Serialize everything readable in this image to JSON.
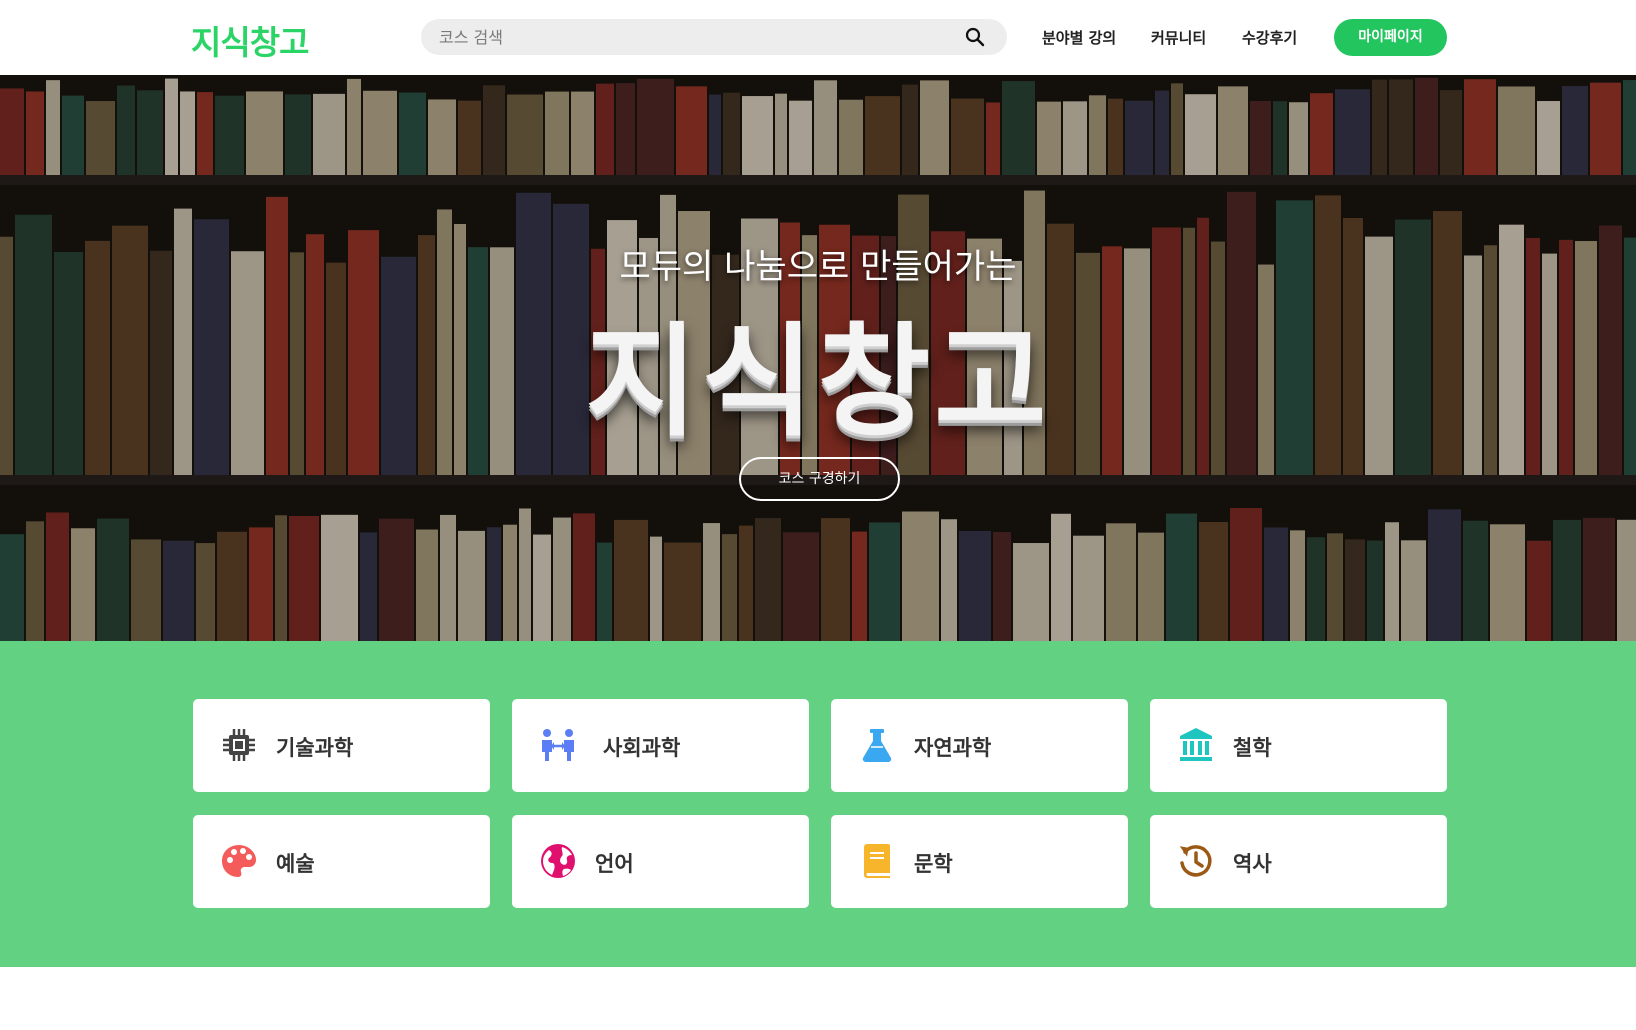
{
  "header": {
    "logo": "지식창고",
    "search_placeholder": "코스 검색",
    "nav": [
      "분야별 강의",
      "커뮤니티",
      "수강후기"
    ],
    "mypage": "마이페이지"
  },
  "hero": {
    "subtitle": "모두의 나눔으로 만들어가는",
    "title": "지식창고",
    "button": "코스 구경하기"
  },
  "categories": [
    {
      "label": "기술과학",
      "icon": "chip-icon",
      "color": "#444444"
    },
    {
      "label": "사회과학",
      "icon": "people-icon",
      "color": "#5b7df5"
    },
    {
      "label": "자연과학",
      "icon": "flask-icon",
      "color": "#3aa8f0"
    },
    {
      "label": "철학",
      "icon": "building-columns-icon",
      "color": "#1fc6c0"
    },
    {
      "label": "예술",
      "icon": "palette-icon",
      "color": "#f45b5b"
    },
    {
      "label": "언어",
      "icon": "globe-icon",
      "color": "#e0106f"
    },
    {
      "label": "문학",
      "icon": "book-icon",
      "color": "#f7b52b"
    },
    {
      "label": "역사",
      "icon": "history-icon",
      "color": "#9a5a15"
    }
  ],
  "colors": {
    "brand": "#22c55e",
    "category_bg": "#62d182"
  }
}
